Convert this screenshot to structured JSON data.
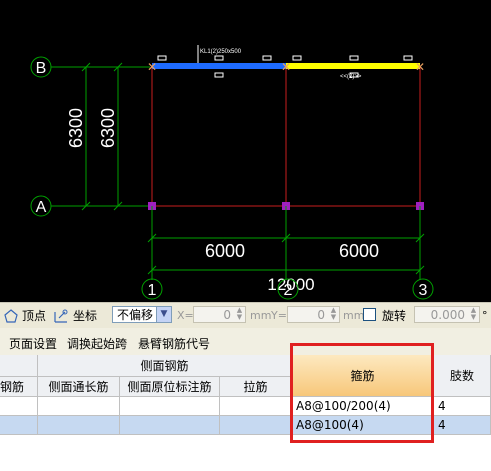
{
  "cad": {
    "axis_b": "B",
    "axis_a": "A",
    "axis_1": "1",
    "axis_2": "2",
    "axis_3": "3",
    "dim_left_outer": "6300",
    "dim_left_inner": "6300",
    "dim_span1": "6000",
    "dim_span2": "6000",
    "dim_total": "12000",
    "beam_label_left": "KL1(2)250x500",
    "beam_label_right": "<<(2)>>"
  },
  "toolbar": {
    "vertex_label": "顶点",
    "coord_label": "坐标",
    "offset_value": "不偏移",
    "x_label": "X=",
    "x_value": "0",
    "x_unit": "mm",
    "y_label": "Y=",
    "y_value": "0",
    "y_unit": "mm",
    "rotate_label": "旋转",
    "rotate_value": "0.000",
    "degree": "°"
  },
  "menu": {
    "page_setup": "页面设置",
    "swap_start": "调换起始跨",
    "cantilever_code": "悬臂钢筋代号"
  },
  "grid": {
    "group_side": "侧面钢筋",
    "col_partial": "钢筋",
    "col_side_long": "侧面通长筋",
    "col_side_orig": "侧面原位标注筋",
    "col_tie": "拉筋",
    "col_stirrup": "箍筋",
    "col_legs": "肢数",
    "rows": [
      {
        "stirrup": "A8@100/200(4)",
        "legs": "4"
      },
      {
        "stirrup": "A8@100(4)",
        "legs": "4"
      }
    ]
  },
  "colors": {
    "beam_blue": "#1e6bff",
    "beam_yellow": "#ffff00",
    "axis_green": "#00a000",
    "grid_red": "#c81e1e",
    "highlight_red": "#e02020"
  }
}
